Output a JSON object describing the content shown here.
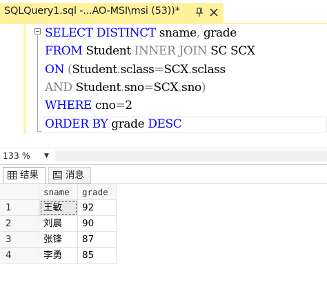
{
  "tab": {
    "title": "SQLQuery1.sql -...AO-MSI\\msi (53))*",
    "pin_icon": "pin-icon",
    "close_icon": "close-icon"
  },
  "editor": {
    "lines": [
      {
        "tokens": [
          {
            "t": "SELECT",
            "c": "kw"
          },
          {
            "t": " ",
            "c": "plain"
          },
          {
            "t": "DISTINCT",
            "c": "kw"
          },
          {
            "t": " sname",
            "c": "plain"
          },
          {
            "t": ",",
            "c": "gray"
          },
          {
            "t": " grade",
            "c": "plain"
          }
        ]
      },
      {
        "tokens": [
          {
            "t": "FROM",
            "c": "kw"
          },
          {
            "t": " Student ",
            "c": "plain"
          },
          {
            "t": "INNER JOIN",
            "c": "gray"
          },
          {
            "t": " SC SCX",
            "c": "plain"
          }
        ]
      },
      {
        "tokens": [
          {
            "t": "ON",
            "c": "kw"
          },
          {
            "t": " (",
            "c": "gray"
          },
          {
            "t": "Student",
            "c": "plain"
          },
          {
            "t": ".",
            "c": "gray"
          },
          {
            "t": "sclass",
            "c": "plain"
          },
          {
            "t": "=",
            "c": "gray"
          },
          {
            "t": "SCX",
            "c": "plain"
          },
          {
            "t": ".",
            "c": "gray"
          },
          {
            "t": "sclass",
            "c": "plain"
          }
        ]
      },
      {
        "tokens": [
          {
            "t": "AND",
            "c": "gray"
          },
          {
            "t": " Student",
            "c": "plain"
          },
          {
            "t": ".",
            "c": "gray"
          },
          {
            "t": "sno",
            "c": "plain"
          },
          {
            "t": "=",
            "c": "gray"
          },
          {
            "t": "SCX",
            "c": "plain"
          },
          {
            "t": ".",
            "c": "gray"
          },
          {
            "t": "sno",
            "c": "plain"
          },
          {
            "t": ")",
            "c": "gray"
          }
        ]
      },
      {
        "tokens": [
          {
            "t": "WHERE",
            "c": "kw"
          },
          {
            "t": " cno",
            "c": "plain"
          },
          {
            "t": "=",
            "c": "gray"
          },
          {
            "t": "2",
            "c": "plain"
          }
        ]
      },
      {
        "tokens": [
          {
            "t": "ORDER BY",
            "c": "kw"
          },
          {
            "t": " grade ",
            "c": "plain"
          },
          {
            "t": "DESC",
            "c": "kw"
          }
        ]
      }
    ]
  },
  "status": {
    "zoom": "133 %"
  },
  "results_tabs": {
    "results_label": "结果",
    "messages_label": "消息",
    "results_icon": "grid-icon",
    "messages_icon": "messages-icon"
  },
  "grid": {
    "columns": [
      "sname",
      "grade"
    ],
    "rows": [
      {
        "num": "1",
        "sname": "王敏",
        "grade": "92"
      },
      {
        "num": "2",
        "sname": "刘晨",
        "grade": "90"
      },
      {
        "num": "3",
        "sname": "张锋",
        "grade": "87"
      },
      {
        "num": "4",
        "sname": "李勇",
        "grade": "85"
      }
    ]
  },
  "colors": {
    "tab_active": "#FFF29D",
    "keyword": "#0000FF",
    "operator": "#808080"
  }
}
